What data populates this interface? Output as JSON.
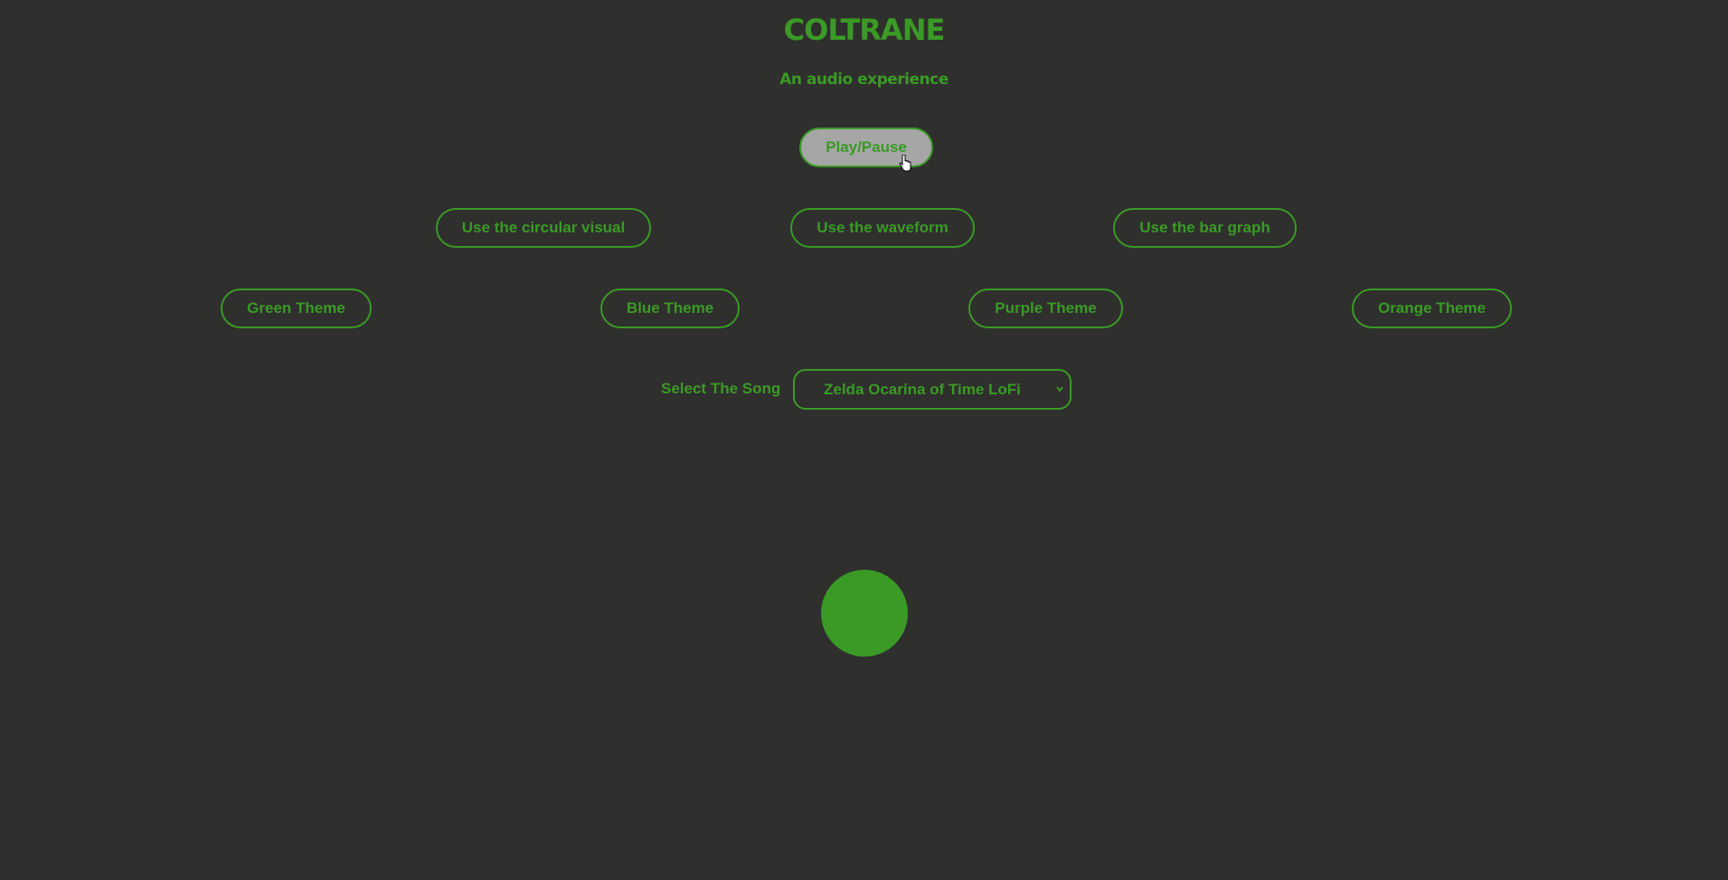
{
  "header": {
    "title": "COLTRANE",
    "subtitle": "An audio experience"
  },
  "controls": {
    "play_pause_label": "Play/Pause"
  },
  "visual_modes": [
    {
      "label": "Use the circular visual"
    },
    {
      "label": "Use the waveform"
    },
    {
      "label": "Use the bar graph"
    }
  ],
  "themes": [
    {
      "label": "Green Theme"
    },
    {
      "label": "Blue Theme"
    },
    {
      "label": "Purple Theme"
    },
    {
      "label": "Orange Theme"
    }
  ],
  "song": {
    "label": "Select The Song",
    "selected": "Zelda Ocarina of Time LoFi"
  },
  "colors": {
    "background": "#2f2f2e",
    "accent": "#3a9a25",
    "active_button_bg": "#a6a6a6"
  },
  "icons": {
    "select_chevron": "chevron-down-icon",
    "pointer": "hand-pointer-icon"
  }
}
